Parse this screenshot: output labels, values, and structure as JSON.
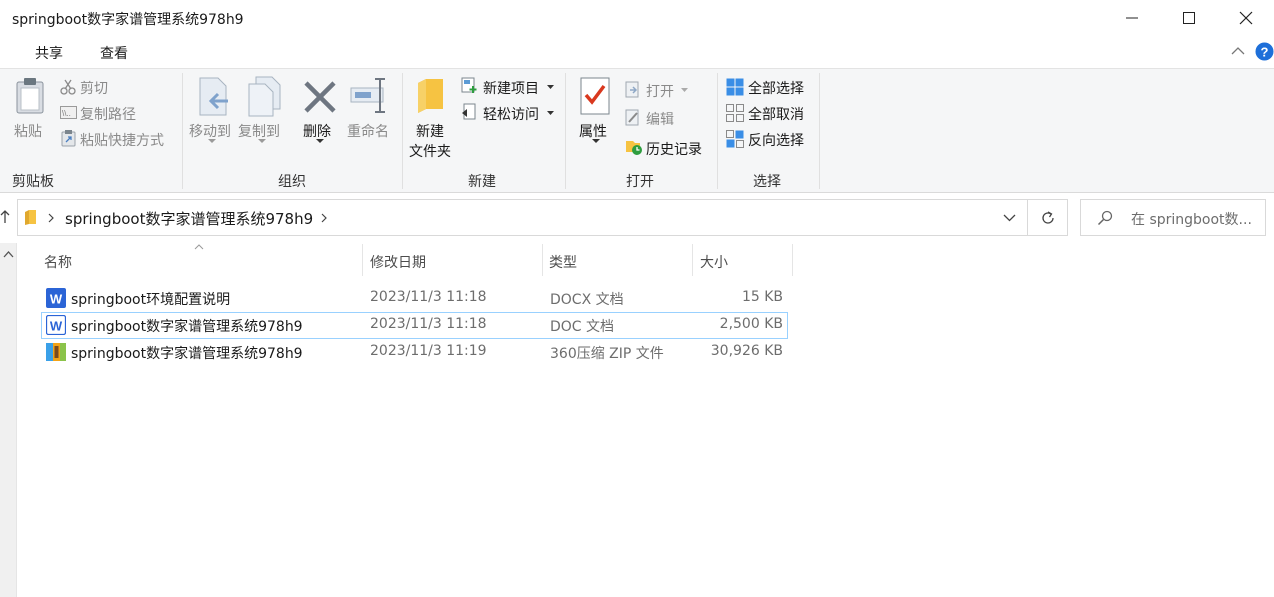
{
  "window": {
    "title": "springboot数字家谱管理系统978h9"
  },
  "tabs": [
    "共享",
    "查看"
  ],
  "ribbon": {
    "clipboard": {
      "paste": "粘贴",
      "cut": "剪切",
      "copy_path": "复制路径",
      "paste_shortcut": "粘贴快捷方式",
      "group_label": "剪贴板"
    },
    "organize": {
      "move_to": "移动到",
      "copy_to": "复制到",
      "delete": "删除",
      "rename": "重命名",
      "group_label": "组织"
    },
    "new": {
      "new_folder_line1": "新建",
      "new_folder_line2": "文件夹",
      "new_item": "新建项目",
      "easy_access": "轻松访问",
      "group_label": "新建"
    },
    "open": {
      "properties": "属性",
      "open": "打开",
      "edit": "编辑",
      "history": "历史记录",
      "group_label": "打开"
    },
    "select": {
      "select_all": "全部选择",
      "select_none": "全部取消",
      "invert": "反向选择",
      "group_label": "选择"
    }
  },
  "address": {
    "path": "springboot数字家谱管理系统978h9"
  },
  "search": {
    "placeholder": "在 springboot数..."
  },
  "columns": {
    "name": "名称",
    "date": "修改日期",
    "type": "类型",
    "size": "大小"
  },
  "files": [
    {
      "name": "springboot环境配置说明",
      "date": "2023/11/3 11:18",
      "type": "DOCX 文档",
      "size": "15 KB",
      "icon": "word-docx-icon"
    },
    {
      "name": "springboot数字家谱管理系统978h9",
      "date": "2023/11/3 11:18",
      "type": "DOC 文档",
      "size": "2,500 KB",
      "icon": "word-doc-icon"
    },
    {
      "name": "springboot数字家谱管理系统978h9",
      "date": "2023/11/3 11:19",
      "type": "360压缩 ZIP 文件",
      "size": "30,926 KB",
      "icon": "zip-archive-icon"
    }
  ],
  "colors": {
    "accent_blue": "#2b579a",
    "selection_border": "#99d1ff",
    "folder_yellow": "#f6c342",
    "help_blue": "#1e6fd9"
  }
}
